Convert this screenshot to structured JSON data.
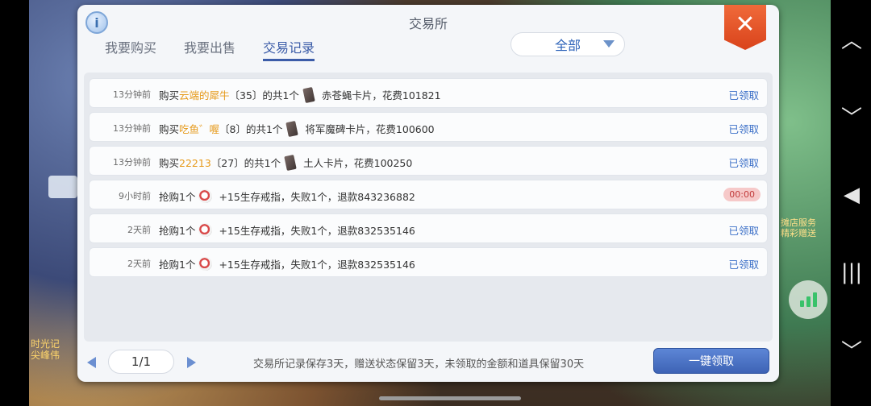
{
  "window": {
    "title": "交易所"
  },
  "tabs": [
    {
      "label": "我要购买"
    },
    {
      "label": "我要出售"
    },
    {
      "label": "交易记录"
    }
  ],
  "filter": {
    "value": "全部"
  },
  "records": [
    {
      "time": "13分钟前",
      "prefix": "购买",
      "highlight": "云端的犀牛",
      "suffix": "〔35〕的共1个",
      "item": "赤苍蝇卡片，花费101821",
      "status": "已领取"
    },
    {
      "time": "13分钟前",
      "prefix": "购买",
      "highlight": "吃鱼゛喔",
      "suffix": "〔8〕的共1个",
      "item": "将军魔碑卡片，花费100600",
      "status": "已领取"
    },
    {
      "time": "13分钟前",
      "prefix": "购买",
      "highlight": "22213",
      "suffix": "〔27〕的共1个",
      "item": "土人卡片，花费100250",
      "status": "已领取"
    },
    {
      "time": "9小时前",
      "prefix": "抢购1个",
      "highlight": "",
      "suffix": "",
      "item": "+15生存戒指，失败1个，退款843236882",
      "status": "00:00"
    },
    {
      "time": "2天前",
      "prefix": "抢购1个",
      "highlight": "",
      "suffix": "",
      "item": "+15生存戒指，失败1个，退款832535146",
      "status": "已领取"
    },
    {
      "time": "2天前",
      "prefix": "抢购1个",
      "highlight": "",
      "suffix": "",
      "item": "+15生存戒指，失败1个，退款832535146",
      "status": "已领取"
    }
  ],
  "pagination": {
    "page": "1/1"
  },
  "footer": {
    "notice": "交易所记录保存3天，赠送状态保留3天，未领取的金额和道具保留30天",
    "claim_all_label": "一键领取"
  },
  "game_overlay": {
    "left_text_1": "时光记",
    "left_text_2": "尖峰伟",
    "right_text_1": "摊店服务",
    "right_text_2": "精彩赠送"
  },
  "colors": {
    "accent": "#3b5ca8",
    "highlight": "#e69a1b",
    "close": "#e4552a"
  }
}
